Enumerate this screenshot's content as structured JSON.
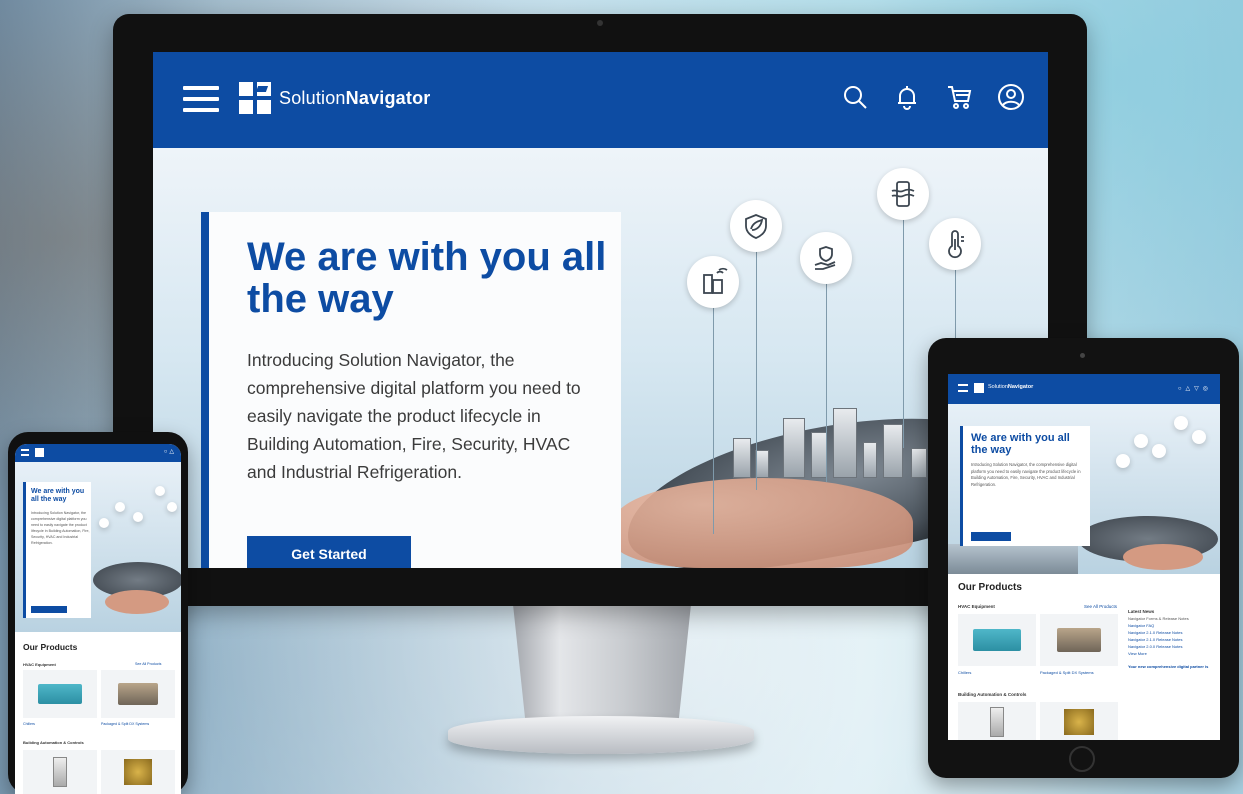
{
  "brand": {
    "name_light": "Solution",
    "name_bold": "Navigator",
    "primary": "#0d4ca3"
  },
  "nav": {
    "menu_icon": "hamburger-icon",
    "icons": [
      "search-icon",
      "bell-icon",
      "cart-icon",
      "user-icon"
    ]
  },
  "hero": {
    "title": "We are with you all the way",
    "body": "Introducing Solution Navigator, the comprehensive digital platform you need to easily navigate the product lifecycle in Building Automation, Fire, Security, HVAC and Industrial Refrigeration.",
    "cta": "Get Started",
    "bubble_icons": [
      "building-icon",
      "shield-leaf-icon",
      "hand-shield-icon",
      "phone-airflow-icon",
      "thermometer-icon"
    ]
  },
  "tablet": {
    "hero_title": "We are with you all the way",
    "hero_body": "Introducing Solution Navigator, the comprehensive digital platform you need to easily navigate the product lifecycle in Building Automation, Fire, Security, HVAC and Industrial Refrigeration.",
    "products_title": "Our Products",
    "hvac_heading": "HVAC Equipment",
    "see_all": "See All Products",
    "product_1": "Chillers",
    "product_2": "Packaged & Split DX Systems",
    "bac_heading": "Building Automation & Controls",
    "news_title": "Latest News",
    "news_items": [
      "Navigator Forms & Release Notes",
      "Navigator FAQ",
      "Navigator 2.1.0 Release Notes",
      "Navigator 2.1.0 Release Notes",
      "Navigator 2.0.0 Release Notes",
      "View More"
    ],
    "news_feature": "Your new comprehensive digital partner is"
  },
  "phone": {
    "hero_title": "We are with you all the way",
    "hero_body": "Introducing Solution Navigator, the comprehensive digital platform you need to easily navigate the product lifecycle in Building Automation, Fire, Security, HVAC and Industrial Refrigeration.",
    "products_title": "Our Products",
    "hvac_heading": "HVAC Equipment",
    "see_all": "See All Products",
    "product_1": "Chillers",
    "product_2": "Packaged & Split DX Systems",
    "bac_heading": "Building Automation & Controls"
  }
}
